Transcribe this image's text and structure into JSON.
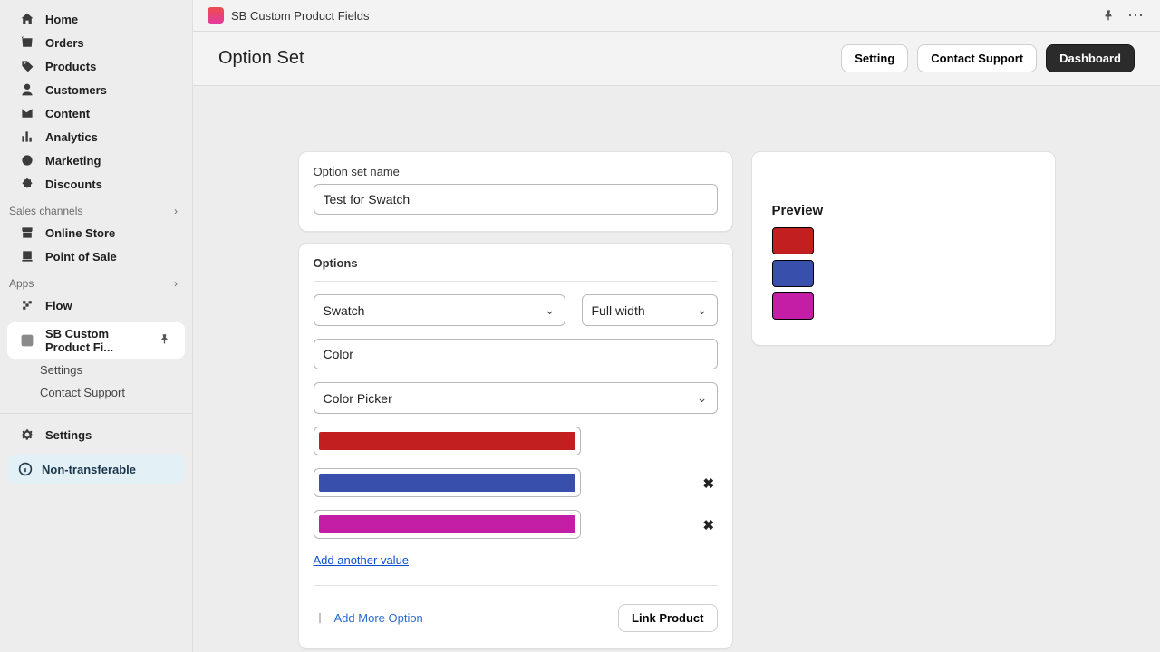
{
  "sidebar": {
    "items": [
      {
        "label": "Home",
        "icon": "home-icon"
      },
      {
        "label": "Orders",
        "icon": "orders-icon"
      },
      {
        "label": "Products",
        "icon": "products-icon"
      },
      {
        "label": "Customers",
        "icon": "customers-icon"
      },
      {
        "label": "Content",
        "icon": "content-icon"
      },
      {
        "label": "Analytics",
        "icon": "analytics-icon"
      },
      {
        "label": "Marketing",
        "icon": "marketing-icon"
      },
      {
        "label": "Discounts",
        "icon": "discounts-icon"
      }
    ],
    "channels_header": "Sales channels",
    "channels": [
      {
        "label": "Online Store"
      },
      {
        "label": "Point of Sale"
      }
    ],
    "apps_header": "Apps",
    "apps": [
      {
        "label": "Flow"
      }
    ],
    "active_app": {
      "label": "SB Custom Product Fi...",
      "children": [
        "Settings",
        "Contact Support"
      ]
    },
    "settings_label": "Settings",
    "badge": "Non-transferable"
  },
  "topbar": {
    "app_name": "SB Custom Product Fields"
  },
  "header": {
    "title": "Option Set",
    "buttons": {
      "setting": "Setting",
      "support": "Contact Support",
      "dashboard": "Dashboard"
    }
  },
  "option_set": {
    "name_label": "Option set name",
    "name_value": "Test for Swatch",
    "options_label": "Options",
    "type": "Swatch",
    "width": "Full width",
    "field_name": "Color",
    "picker_mode": "Color Picker",
    "colors": [
      {
        "hex": "#c22020",
        "removable": false
      },
      {
        "hex": "#3850ac",
        "removable": true
      },
      {
        "hex": "#c41da6",
        "removable": true
      }
    ],
    "add_value": "Add another value",
    "add_option": "Add More Option",
    "link_product": "Link Product"
  },
  "preview": {
    "title": "Preview",
    "swatches": [
      "#c22020",
      "#3850ac",
      "#c41da6"
    ]
  }
}
